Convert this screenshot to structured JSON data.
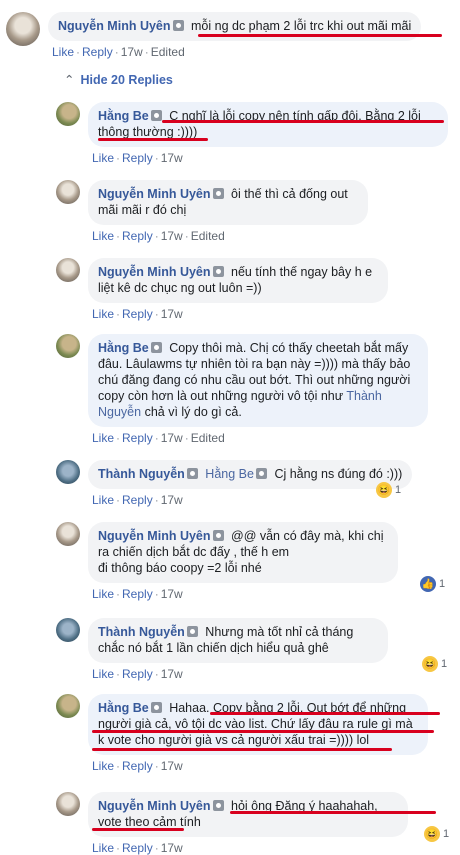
{
  "top_comment": {
    "author": "Nguyễn Minh Uyên",
    "text": "mỗi ng dc phạm 2 lỗi trc khi out mãi mãi",
    "like": "Like",
    "reply": "Reply",
    "time": "17w",
    "edited": "Edited"
  },
  "hide_replies": "Hide 20 Replies",
  "replies": [
    {
      "author": "Hằng Be",
      "text": "C nghĩ là lỗi copy nên tính gấp đôi. Bằng 2 lỗi thông thường :))))",
      "time": "17w"
    },
    {
      "author": "Nguyễn Minh Uyên",
      "text": "ôi thế thì cả đống out mãi mãi r đó chị",
      "time": "17w",
      "edited": "Edited"
    },
    {
      "author": "Nguyễn Minh Uyên",
      "text": "nếu tính thế ngay bây h e liệt kê dc chục ng out luôn =))",
      "time": "17w"
    },
    {
      "author": "Hằng Be",
      "text_a": "Copy thôi mà. Chị có thấy cheetah bắt mấy đâu. Lâulawms tự nhiên tòi ra bạn này =)))) mà thấy bảo chú đăng đang có nhu cầu out bớt. Thì out những người copy còn hơn là out những người vô tội như",
      "mention": "Thành Nguyễn",
      "text_b": "chả vì lý do gì cả.",
      "time": "17w",
      "edited": "Edited"
    },
    {
      "author": "Thành Nguyễn",
      "mention": "Hằng Be",
      "text": "Cj hằng ns đúng đó :)))",
      "time": "17w",
      "reaction_count": "1"
    },
    {
      "author": "Nguyễn Minh Uyên",
      "text_a": "@@ vẫn có đây mà, khi chị ra chiến dịch bắt dc đấy , thế h em",
      "text_b": "đi thông báo coopy =2 lỗi nhé",
      "time": "17w",
      "reaction_count": "1"
    },
    {
      "author": "Thành Nguyễn",
      "text": "Nhưng mà tốt nhỉ cả tháng chắc nó bắt 1 lần chiến dịch hiểu quả ghê",
      "time": "17w",
      "reaction_count": "1"
    },
    {
      "author": "Hằng Be",
      "text": "Hahaa. Copy bằng 2 lỗi. Out bớt để những người già cả, vô tội dc vào list. Chứ lấy đâu ra rule gì mà k vote cho người già vs cả người xấu trai =)))) lol",
      "time": "17w"
    },
    {
      "author": "Nguyễn Minh Uyên",
      "text": "hỏi ông Đăng ý haahahah, vote theo cảm tính",
      "time": "17w",
      "reaction_count": "1"
    }
  ],
  "labels": {
    "like": "Like",
    "reply": "Reply"
  }
}
